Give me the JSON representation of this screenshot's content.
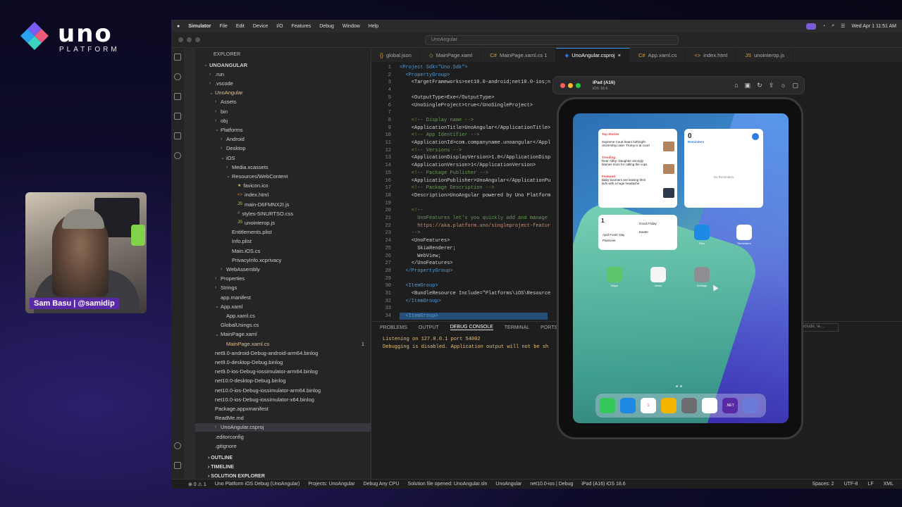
{
  "brand": {
    "word": "uno",
    "sub": "PLATFORM"
  },
  "webcam": {
    "name_tag": "Sam Basu | @samidip"
  },
  "menubar": {
    "items": [
      "Simulator",
      "File",
      "Edit",
      "Device",
      "I/O",
      "Features",
      "Debug",
      "Window",
      "Help"
    ],
    "clock": "Wed Apr 1  11:51 AM"
  },
  "titlebar": {
    "search": "UnoAngular"
  },
  "explorer": {
    "header": "EXPLORER",
    "rows": [
      {
        "label": "UNOANGULAR",
        "indent": 0,
        "chev": "⌄"
      },
      {
        "label": ".run",
        "indent": 1,
        "chev": "›"
      },
      {
        "label": ".vscode",
        "indent": 1,
        "chev": "›"
      },
      {
        "label": "UnoAngular",
        "indent": 1,
        "chev": "⌄",
        "color": "#e2c08d"
      },
      {
        "label": "Assets",
        "indent": 2,
        "chev": "›"
      },
      {
        "label": "bin",
        "indent": 2,
        "chev": "›"
      },
      {
        "label": "obj",
        "indent": 2,
        "chev": "›"
      },
      {
        "label": "Platforms",
        "indent": 2,
        "chev": "⌄"
      },
      {
        "label": "Android",
        "indent": 3,
        "chev": "›"
      },
      {
        "label": "Desktop",
        "indent": 3,
        "chev": "›"
      },
      {
        "label": "iOS",
        "indent": 3,
        "chev": "⌄"
      },
      {
        "label": "Media.xcassets",
        "indent": 4,
        "chev": "›"
      },
      {
        "label": "Resources/WebContent",
        "indent": 4,
        "chev": "⌄"
      },
      {
        "label": "favicon.ico",
        "indent": 5,
        "chev": "",
        "icon": "★",
        "iconColor": "#e2c541"
      },
      {
        "label": "index.html",
        "indent": 5,
        "chev": "",
        "icon": "<>",
        "iconColor": "#e37933"
      },
      {
        "label": "main-D6FMNX2I.js",
        "indent": 5,
        "chev": "",
        "icon": "JS",
        "iconColor": "#cbcb41"
      },
      {
        "label": "styles-5INURTSO.css",
        "indent": 5,
        "chev": "",
        "icon": "#",
        "iconColor": "#519aba"
      },
      {
        "label": "unointerop.js",
        "indent": 5,
        "chev": "",
        "icon": "JS",
        "iconColor": "#cbcb41"
      },
      {
        "label": "Entitlements.plist",
        "indent": 4,
        "chev": ""
      },
      {
        "label": "Info.plist",
        "indent": 4,
        "chev": ""
      },
      {
        "label": "Main.iOS.cs",
        "indent": 4,
        "chev": ""
      },
      {
        "label": "PrivacyInfo.xcprivacy",
        "indent": 4,
        "chev": ""
      },
      {
        "label": "WebAssembly",
        "indent": 3,
        "chev": "›"
      },
      {
        "label": "Properties",
        "indent": 2,
        "chev": "›"
      },
      {
        "label": "Strings",
        "indent": 2,
        "chev": "›"
      },
      {
        "label": "app.manifest",
        "indent": 2,
        "chev": ""
      },
      {
        "label": "App.xaml",
        "indent": 2,
        "chev": "⌄"
      },
      {
        "label": "App.xaml.cs",
        "indent": 3,
        "chev": ""
      },
      {
        "label": "GlobalUsings.cs",
        "indent": 2,
        "chev": ""
      },
      {
        "label": "MainPage.xaml",
        "indent": 2,
        "chev": "⌄"
      },
      {
        "label": "MainPage.xaml.cs",
        "indent": 3,
        "chev": "",
        "color": "#e2c08d",
        "badge": "1"
      },
      {
        "label": "net9.0-android-Debug-android-arm64.binlog",
        "indent": 1,
        "chev": ""
      },
      {
        "label": "net9.0-desktop-Debug.binlog",
        "indent": 1,
        "chev": ""
      },
      {
        "label": "net9.0-ios-Debug-iossimulator-arm64.binlog",
        "indent": 1,
        "chev": ""
      },
      {
        "label": "net10.0-desktop-Debug.binlog",
        "indent": 1,
        "chev": ""
      },
      {
        "label": "net10.0-ios-Debug-iossimulator-arm64.binlog",
        "indent": 1,
        "chev": ""
      },
      {
        "label": "net10.0-ios-Debug-iossimulator-x64.binlog",
        "indent": 1,
        "chev": ""
      },
      {
        "label": "Package.appxmanifest",
        "indent": 1,
        "chev": ""
      },
      {
        "label": "ReadMe.md",
        "indent": 1,
        "chev": ""
      },
      {
        "label": "UnoAngular.csproj",
        "indent": 2,
        "chev": "›",
        "selected": true
      },
      {
        "label": ".editorconfig",
        "indent": 1,
        "chev": ""
      },
      {
        "label": ".gitignore",
        "indent": 1,
        "chev": ""
      }
    ],
    "sections": [
      "OUTLINE",
      "TIMELINE",
      "SOLUTION EXPLORER"
    ]
  },
  "tabs": [
    {
      "label": "global.json",
      "icon": "{}"
    },
    {
      "label": "MainPage.xaml",
      "icon": "◇"
    },
    {
      "label": "MainPage.xaml.cs 1",
      "icon": "C#"
    },
    {
      "label": "UnoAngular.csproj",
      "icon": "◈",
      "active": true
    },
    {
      "label": "App.xaml.cs",
      "icon": "C#"
    },
    {
      "label": "index.html",
      "icon": "<>"
    },
    {
      "label": "unointerop.js",
      "icon": "JS"
    }
  ],
  "code": [
    {
      "n": "1",
      "t": "<Project Sdk=\"Uno.Sdk\">",
      "k": "tag"
    },
    {
      "n": "2",
      "t": "  <PropertyGroup>",
      "k": "tag"
    },
    {
      "n": "3",
      "t": "    <TargetFrameworks>net10.0-android;net10.0-ios;n",
      "k": ""
    },
    {
      "n": "4",
      "t": "",
      "k": ""
    },
    {
      "n": "5",
      "t": "    <OutputType>Exe</OutputType>",
      "k": ""
    },
    {
      "n": "6",
      "t": "    <UnoSingleProject>true</UnoSingleProject>",
      "k": ""
    },
    {
      "n": "7",
      "t": "",
      "k": ""
    },
    {
      "n": "8",
      "t": "    <!-- Display name -->",
      "k": "cmt"
    },
    {
      "n": "9",
      "t": "    <ApplicationTitle>UnoAngular</ApplicationTitle>",
      "k": ""
    },
    {
      "n": "10",
      "t": "    <!-- App Identifier -->",
      "k": "cmt"
    },
    {
      "n": "11",
      "t": "    <ApplicationId>com.companyname.unoangular</Appl",
      "k": ""
    },
    {
      "n": "12",
      "t": "    <!-- Versions -->",
      "k": "cmt"
    },
    {
      "n": "13",
      "t": "    <ApplicationDisplayVersion>1.0</ApplicationDisp",
      "k": ""
    },
    {
      "n": "14",
      "t": "    <ApplicationVersion>1</ApplicationVersion>",
      "k": ""
    },
    {
      "n": "15",
      "t": "    <!-- Package Publisher -->",
      "k": "cmt"
    },
    {
      "n": "16",
      "t": "    <ApplicationPublisher>UnoAngular</ApplicationPu",
      "k": ""
    },
    {
      "n": "17",
      "t": "    <!-- Package Description -->",
      "k": "cmt"
    },
    {
      "n": "18",
      "t": "    <Description>UnoAngular powered by Uno Platform",
      "k": ""
    },
    {
      "n": "19",
      "t": "",
      "k": ""
    },
    {
      "n": "20",
      "t": "    <!--",
      "k": "cmt"
    },
    {
      "n": "21",
      "t": "      UnoFeatures let's you quickly add and manage",
      "k": "cmt"
    },
    {
      "n": "22",
      "t": "      https://aka.platform.uno/singleproject-featur",
      "k": "url"
    },
    {
      "n": "23",
      "t": "    -->",
      "k": "cmt"
    },
    {
      "n": "24",
      "t": "    <UnoFeatures>",
      "k": ""
    },
    {
      "n": "25",
      "t": "      SkiaRenderer;",
      "k": ""
    },
    {
      "n": "26",
      "t": "      WebView;",
      "k": ""
    },
    {
      "n": "27",
      "t": "    </UnoFeatures>",
      "k": ""
    },
    {
      "n": "28",
      "t": "  </PropertyGroup>",
      "k": "tag"
    },
    {
      "n": "29",
      "t": "",
      "k": ""
    },
    {
      "n": "30",
      "t": "  <ItemGroup>",
      "k": "tag"
    },
    {
      "n": "31",
      "t": "    <BundleResource Include=\"Platforms\\iOS\\Resource",
      "k": ""
    },
    {
      "n": "32",
      "t": "  </ItemGroup>",
      "k": "tag"
    },
    {
      "n": "33",
      "t": "",
      "k": ""
    },
    {
      "n": "34",
      "t": "  <ItemGroup>",
      "k": "tag"
    }
  ],
  "panel": {
    "tabs": [
      "PROBLEMS",
      "OUTPUT",
      "DEBUG CONSOLE",
      "TERMINAL",
      "PORTS"
    ],
    "active_tab": "DEBUG CONSOLE",
    "filter": "exclude, \\e...",
    "lines": [
      "Listening on 127.0.0.1 port 54002",
      "Debugging is disabled. Application output will not be sh"
    ]
  },
  "status": {
    "left": [
      "⊗ 0 ⚠ 1",
      "Uno Platform iOS Debug (UnoAngular)",
      "Projects: UnoAngular",
      "Debug Any CPU",
      "Solution file opened: UnoAngular.sln",
      "UnoAngular",
      "net10.0-ios | Debug",
      "iPad (A16) iOS 18.6"
    ],
    "right": [
      "Spaces: 2",
      "UTF-8",
      "LF",
      "XML"
    ]
  },
  "simulator": {
    "title": "iPad (A16)",
    "subtitle": "iOS 18.6",
    "widgets": {
      "news": {
        "header": "Top Stories",
        "items": [
          {
            "text": "Supreme Court hears birthright citizenship case; Trump is at court"
          },
          {
            "tag": "Trending",
            "text": "Dear Abby: Daughter strongly blames mom for calling the cops"
          },
          {
            "tag": "Featured",
            "text": "Baby boomers are leaving their kids with a huge headache"
          }
        ]
      },
      "reminders": {
        "count": "0",
        "label": "Reminders",
        "empty": "No Reminders"
      },
      "calendar": {
        "count": "1",
        "events": [
          "Good Friday",
          "Easter",
          "April Fools' Day",
          "Passover"
        ]
      }
    },
    "home_apps": [
      {
        "label": "Files",
        "color": "#1e88e5"
      },
      {
        "label": "Reminders",
        "color": "#ffffff"
      },
      {
        "label": "Maps",
        "color": "#5dc46a"
      },
      {
        "label": "News",
        "color": "#f5f5f5"
      },
      {
        "label": "Settings",
        "color": "#8e8e93"
      }
    ],
    "dock_apps": [
      {
        "name": "messages-icon",
        "color": "#34c759"
      },
      {
        "name": "safari-icon",
        "color": "#1e88e5"
      },
      {
        "name": "calendar-icon",
        "color": "#ffffff",
        "text": "1"
      },
      {
        "name": "photos-icon",
        "color": "#f4b400"
      },
      {
        "name": "uno-app-icon",
        "color": "#6c6c70"
      },
      {
        "name": "uno-angular-icon",
        "color": "#ffffff"
      },
      {
        "name": "dotnet-icon",
        "color": "#5a2aa6",
        "text": ".NET"
      },
      {
        "name": "app-library-icon",
        "color": "#6d7bd8"
      }
    ]
  }
}
